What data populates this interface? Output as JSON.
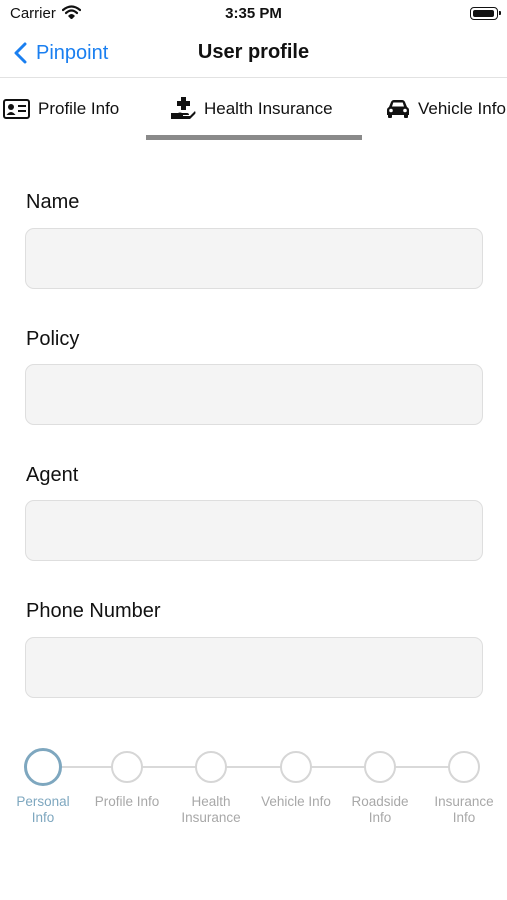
{
  "status_bar": {
    "carrier": "Carrier",
    "time": "3:35 PM"
  },
  "nav": {
    "back_label": "Pinpoint",
    "title": "User profile"
  },
  "tabs": [
    {
      "label": "Profile Info",
      "icon": "id-card-icon"
    },
    {
      "label": "Health Insurance",
      "icon": "hand-medical-icon",
      "selected": true
    },
    {
      "label": "Vehicle Info",
      "icon": "car-icon"
    }
  ],
  "form": {
    "fields": [
      {
        "label": "Name",
        "value": ""
      },
      {
        "label": "Policy",
        "value": ""
      },
      {
        "label": "Agent",
        "value": ""
      },
      {
        "label": "Phone Number",
        "value": ""
      }
    ]
  },
  "stepper": {
    "steps": [
      {
        "label": "Personal\nInfo",
        "active": true
      },
      {
        "label": "Profile Info"
      },
      {
        "label": "Health\nInsurance"
      },
      {
        "label": "Vehicle Info"
      },
      {
        "label": "Roadside\nInfo"
      },
      {
        "label": "Insurance\nInfo"
      }
    ]
  },
  "colors": {
    "accent": "#1a7ff0",
    "step_active": "#7ea7bf",
    "step_inactive": "#d6d6d6",
    "tab_indicator": "#8a8a8a",
    "input_bg": "#f4f4f4"
  }
}
